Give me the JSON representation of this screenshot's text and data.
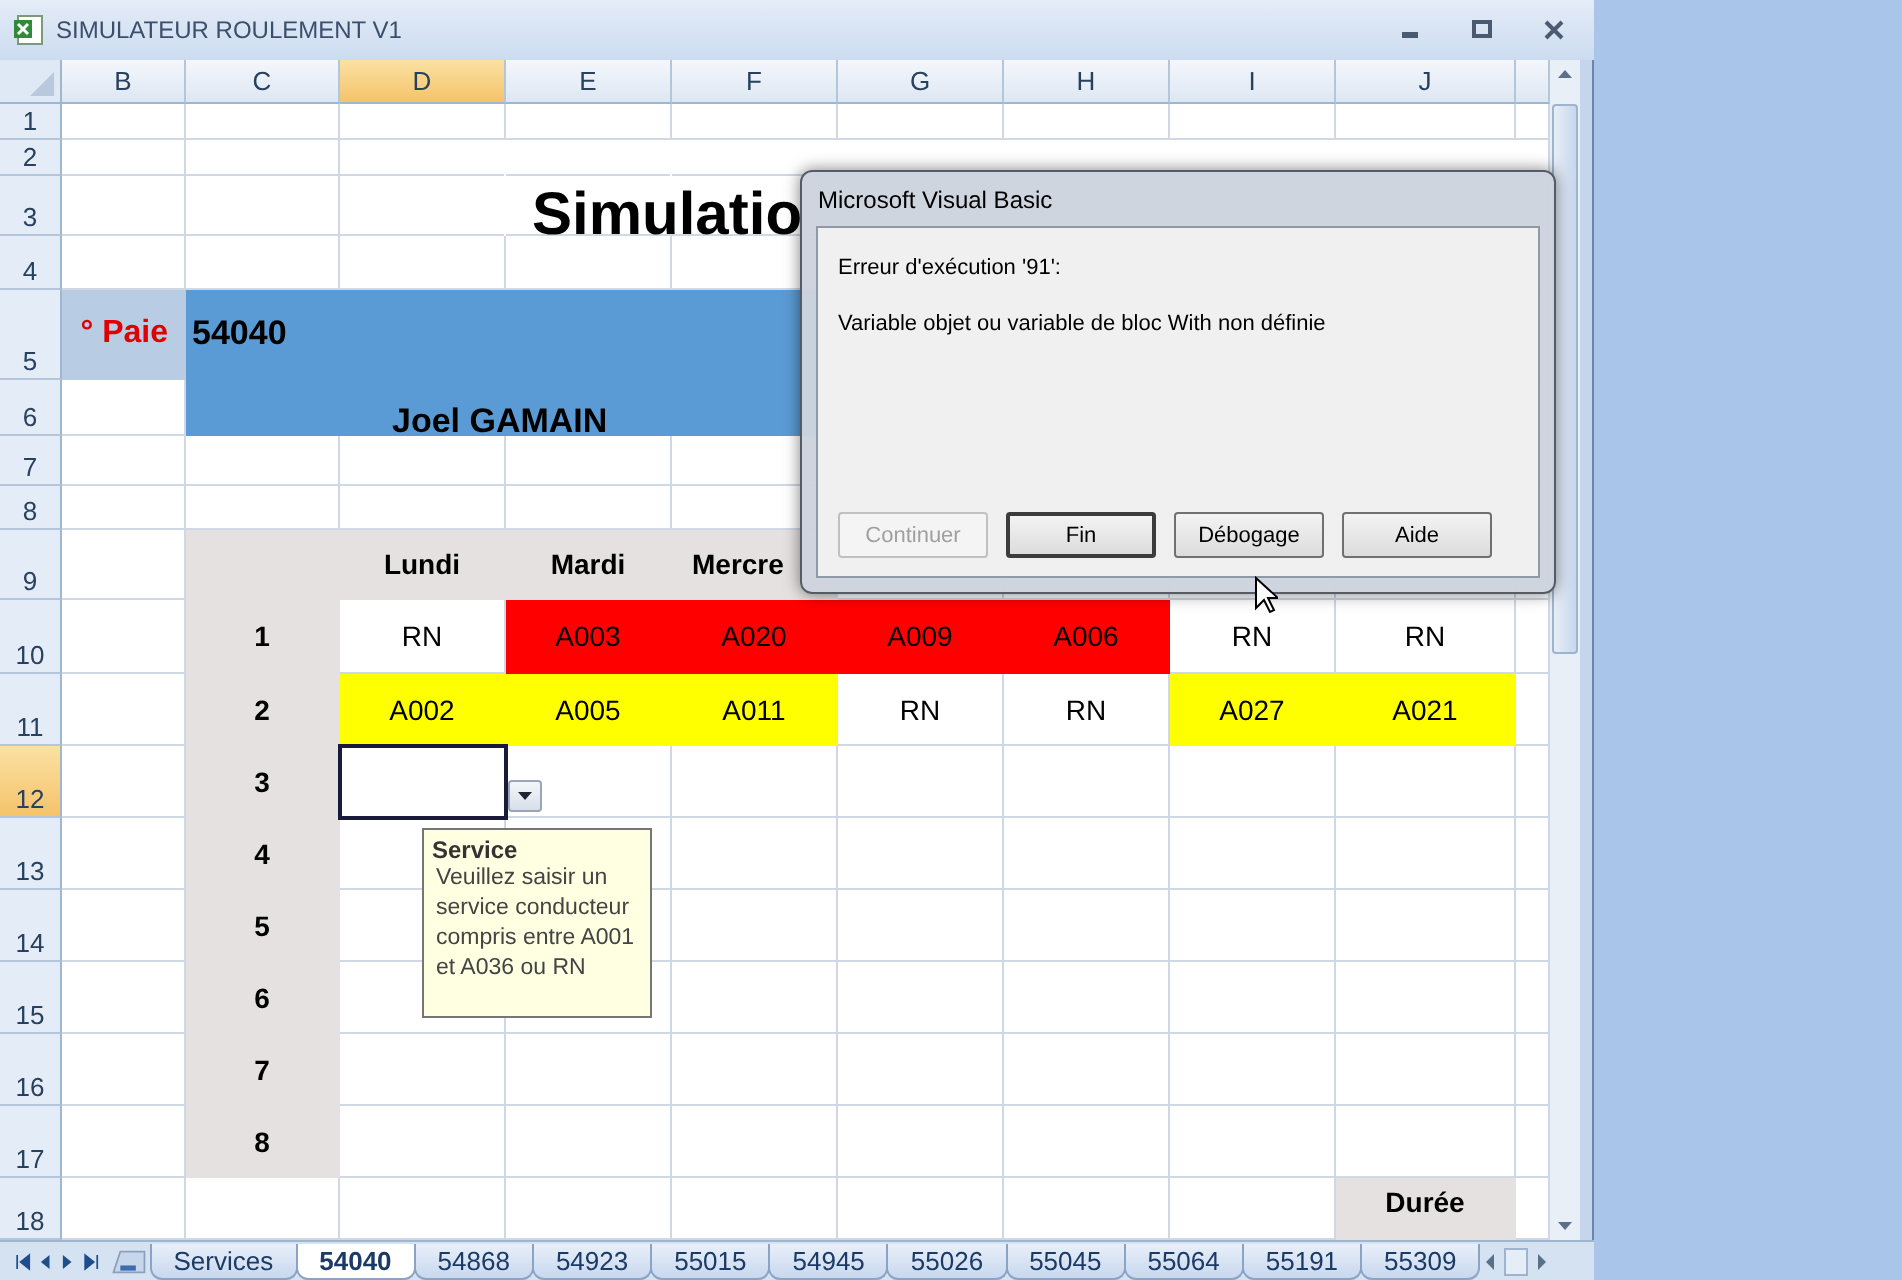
{
  "window": {
    "title": "SIMULATEUR ROULEMENT V1"
  },
  "sheet": {
    "columns": [
      {
        "label": "B",
        "selected": false
      },
      {
        "label": "C",
        "selected": false
      },
      {
        "label": "D",
        "selected": true
      },
      {
        "label": "E",
        "selected": false
      },
      {
        "label": "F",
        "selected": false
      },
      {
        "label": "G",
        "selected": false
      },
      {
        "label": "H",
        "selected": false
      },
      {
        "label": "I",
        "selected": false
      },
      {
        "label": "J",
        "selected": false
      }
    ],
    "rows": [
      {
        "number": "1",
        "selected": false,
        "cells": [
          "",
          "",
          "",
          "",
          "",
          "",
          "",
          "",
          ""
        ]
      },
      {
        "number": "2",
        "selected": false,
        "cells": [
          "",
          "",
          {
            "kind": "merged"
          },
          {
            "kind": "merged"
          },
          {
            "kind": "merged"
          },
          {
            "kind": "merged"
          },
          {
            "kind": "merged"
          },
          {
            "kind": "merged"
          },
          {
            "kind": "merged"
          }
        ]
      },
      {
        "number": "3",
        "selected": false,
        "cells": [
          "",
          "",
          {
            "kind": "merged"
          },
          {
            "kind": "title",
            "text": "Simulatio"
          },
          {
            "kind": "merged"
          },
          {
            "kind": "merged"
          },
          {
            "kind": "merged"
          },
          {
            "kind": "merged"
          },
          {
            "kind": "merged"
          }
        ]
      },
      {
        "number": "4",
        "selected": false,
        "cells": [
          "",
          "",
          "",
          "",
          "",
          "",
          "",
          "",
          ""
        ]
      },
      {
        "number": "5",
        "selected": false,
        "cells": [
          {
            "kind": "label",
            "text": "° Paie"
          },
          {
            "kind": "band",
            "text": "54040"
          },
          {
            "kind": "band"
          },
          {
            "kind": "band"
          },
          {
            "kind": "band"
          },
          "",
          "",
          "",
          ""
        ]
      },
      {
        "number": "6",
        "selected": false,
        "cells": [
          "",
          {
            "kind": "band"
          },
          {
            "kind": "band-name",
            "text": "Joel GAMAIN"
          },
          {
            "kind": "band"
          },
          {
            "kind": "band"
          },
          "",
          "",
          "",
          ""
        ]
      },
      {
        "number": "7",
        "selected": false,
        "cells": [
          "",
          "",
          "",
          "",
          "",
          "",
          "",
          "",
          ""
        ]
      },
      {
        "number": "8",
        "selected": false,
        "cells": [
          "",
          "",
          "",
          "",
          "",
          "",
          "",
          "",
          ""
        ]
      },
      {
        "number": "9",
        "selected": false,
        "cells": [
          "",
          {
            "kind": "index"
          },
          {
            "kind": "header",
            "text": "Lundi"
          },
          {
            "kind": "header",
            "text": "Mardi"
          },
          {
            "kind": "header-left",
            "text": "Mercre"
          },
          "",
          "",
          "",
          ""
        ]
      },
      {
        "number": "10",
        "selected": false,
        "cells": [
          "",
          {
            "kind": "index",
            "text": "1"
          },
          {
            "kind": "data",
            "text": "RN"
          },
          {
            "kind": "data",
            "text": "A003",
            "color": "#ff0000"
          },
          {
            "kind": "data",
            "text": "A020",
            "color": "#ff0000"
          },
          {
            "kind": "data",
            "text": "A009",
            "color": "#ff0000"
          },
          {
            "kind": "data",
            "text": "A006",
            "color": "#ff0000"
          },
          {
            "kind": "data",
            "text": "RN"
          },
          {
            "kind": "data",
            "text": "RN"
          }
        ]
      },
      {
        "number": "11",
        "selected": false,
        "cells": [
          "",
          {
            "kind": "index",
            "text": "2"
          },
          {
            "kind": "data",
            "text": "A002",
            "color": "#ffff00"
          },
          {
            "kind": "data",
            "text": "A005",
            "color": "#ffff00"
          },
          {
            "kind": "data",
            "text": "A011",
            "color": "#ffff00"
          },
          {
            "kind": "data",
            "text": "RN"
          },
          {
            "kind": "data",
            "text": "RN"
          },
          {
            "kind": "data",
            "text": "A027",
            "color": "#ffff00"
          },
          {
            "kind": "data",
            "text": "A021",
            "color": "#ffff00"
          }
        ]
      },
      {
        "number": "12",
        "selected": true,
        "cells": [
          "",
          {
            "kind": "index",
            "text": "3"
          },
          {
            "kind": "active"
          },
          "",
          "",
          "",
          "",
          "",
          ""
        ]
      },
      {
        "number": "13",
        "selected": false,
        "cells": [
          "",
          {
            "kind": "index",
            "text": "4"
          },
          "",
          "",
          "",
          "",
          "",
          "",
          ""
        ]
      },
      {
        "number": "14",
        "selected": false,
        "cells": [
          "",
          {
            "kind": "index",
            "text": "5"
          },
          "",
          "",
          "",
          "",
          "",
          "",
          ""
        ]
      },
      {
        "number": "15",
        "selected": false,
        "cells": [
          "",
          {
            "kind": "index",
            "text": "6"
          },
          "",
          "",
          "",
          "",
          "",
          "",
          ""
        ]
      },
      {
        "number": "16",
        "selected": false,
        "cells": [
          "",
          {
            "kind": "index",
            "text": "7"
          },
          "",
          "",
          "",
          "",
          "",
          "",
          ""
        ]
      },
      {
        "number": "17",
        "selected": false,
        "cells": [
          "",
          {
            "kind": "index",
            "text": "8"
          },
          "",
          "",
          "",
          "",
          "",
          "",
          ""
        ]
      },
      {
        "number": "18",
        "selected": false,
        "cells": [
          "",
          "",
          "",
          "",
          "",
          "",
          "",
          "",
          {
            "kind": "header-top",
            "text": "Durée"
          }
        ]
      }
    ]
  },
  "tooltip": {
    "title": "Service",
    "lines": [
      "Veuillez saisir un",
      "service conducteur",
      "compris entre A001",
      "et A036 ou RN"
    ]
  },
  "tabs": [
    {
      "label": "Services",
      "selected": false
    },
    {
      "label": "54040",
      "selected": true
    },
    {
      "label": "54868",
      "selected": false
    },
    {
      "label": "54923",
      "selected": false
    },
    {
      "label": "55015",
      "selected": false
    },
    {
      "label": "54945",
      "selected": false
    },
    {
      "label": "55026",
      "selected": false
    },
    {
      "label": "55045",
      "selected": false
    },
    {
      "label": "55064",
      "selected": false
    },
    {
      "label": "55191",
      "selected": false
    },
    {
      "label": "55309",
      "selected": false
    }
  ],
  "dialog": {
    "title": "Microsoft Visual Basic",
    "error": "Erreur d'exécution '91':",
    "message": "Variable objet ou variable de bloc With non définie",
    "buttons": [
      {
        "label": "Continuer",
        "disabled": true,
        "focused": false
      },
      {
        "label": "Fin",
        "disabled": false,
        "focused": true
      },
      {
        "label": "Débogage",
        "disabled": false,
        "focused": false
      },
      {
        "label": "Aide",
        "disabled": false,
        "focused": false
      }
    ]
  }
}
